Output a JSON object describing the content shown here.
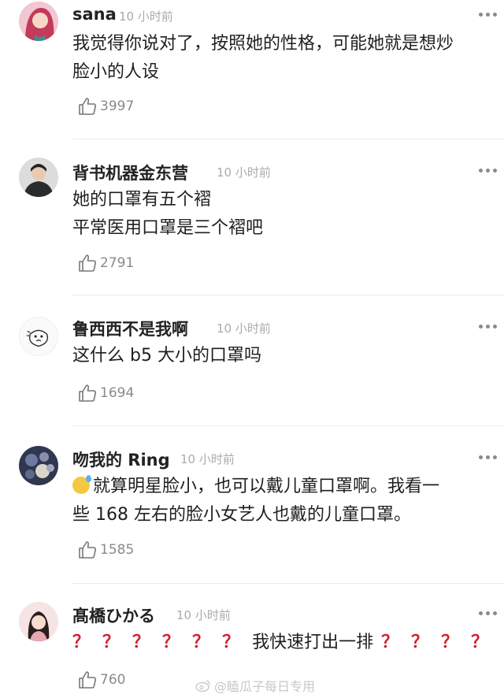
{
  "comments": [
    {
      "username": "sana",
      "time": "10 小时前",
      "lines": [
        "我觉得你说对了，按照她的性格，可能她就是想炒",
        "脸小的人设"
      ],
      "likes": "3997",
      "avatar_color": "#d35a8c"
    },
    {
      "username": "背书机器金东营",
      "time": "10 小时前",
      "lines": [
        "她的口罩有五个褶",
        "平常医用口罩是三个褶吧"
      ],
      "likes": "2791",
      "avatar_color": "#4a4a4a"
    },
    {
      "username": "鲁西西不是我啊",
      "time": "10 小时前",
      "lines": [
        "这什么 b5 大小的口罩吗"
      ],
      "likes": "1694",
      "avatar_color": "#f2f2f2"
    },
    {
      "username": "吻我的 Ring",
      "time": "10 小时前",
      "lines": [
        "就算明星脸小，也可以戴儿童口罩啊。我看一",
        "些 168 左右的脸小女艺人也戴的儿童口罩。"
      ],
      "likes": "1585",
      "avatar_color": "#3a4560"
    },
    {
      "username": "髙橋ひかる",
      "time": "10 小时前",
      "line_middle": "我快速打出一排",
      "qmark": "？",
      "likes": "760",
      "avatar_color": "#f3d6d6"
    }
  ],
  "watermark": "@瞌瓜子每日专用",
  "colors": {
    "accent_red": "#d81e2c",
    "meta_gray": "#aaaaaa"
  },
  "icons": {
    "like": "thumbs-up-icon",
    "more": "more-options-icon",
    "watermark": "weibo-icon",
    "emoji": "sweat-emoji-icon"
  }
}
